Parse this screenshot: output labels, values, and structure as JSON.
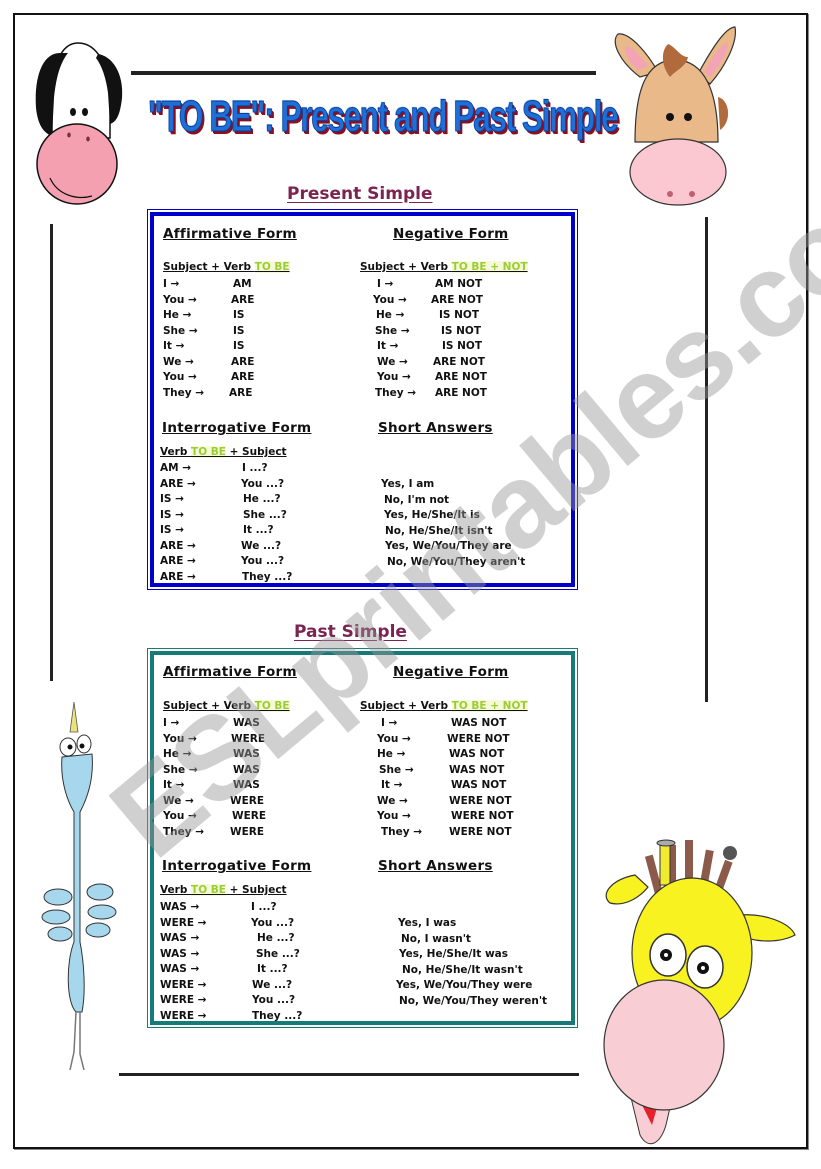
{
  "title": "\"TO BE\": Present and Past Simple",
  "watermark": "ESLprintables.com",
  "colors": {
    "title_blue": "#1f6fd6",
    "title_shadow": "#8a1020",
    "section_title": "#7b2452",
    "present_border": "#0000cc",
    "past_border": "#157a78",
    "highlight": "#9acd32"
  },
  "present": {
    "section_title": "Present Simple",
    "affirmative": {
      "header": "Affirmative Form",
      "formula_prefix": "Subject + Verb ",
      "formula_highlight": "TO BE",
      "rows": [
        {
          "subject": "I →",
          "verb": "AM"
        },
        {
          "subject": "You →",
          "verb": "ARE"
        },
        {
          "subject": "He →",
          "verb": "IS"
        },
        {
          "subject": "She →",
          "verb": "IS"
        },
        {
          "subject": "It →",
          "verb": "IS"
        },
        {
          "subject": "We →",
          "verb": "ARE"
        },
        {
          "subject": "You →",
          "verb": "ARE"
        },
        {
          "subject": "They →",
          "verb": "ARE"
        }
      ]
    },
    "negative": {
      "header": "Negative Form",
      "formula_prefix": "Subject + Verb ",
      "formula_highlight": "TO BE + NOT",
      "rows": [
        {
          "subject": "I →",
          "verb": "AM NOT"
        },
        {
          "subject": "You →",
          "verb": "ARE NOT"
        },
        {
          "subject": "He →",
          "verb": "IS NOT"
        },
        {
          "subject": "She →",
          "verb": "IS NOT"
        },
        {
          "subject": "It →",
          "verb": "IS NOT"
        },
        {
          "subject": "We →",
          "verb": "ARE NOT"
        },
        {
          "subject": "You →",
          "verb": "ARE NOT"
        },
        {
          "subject": "They →",
          "verb": "ARE NOT"
        }
      ]
    },
    "interrogative": {
      "header": "Interrogative Form",
      "formula_prefix": "Verb ",
      "formula_highlight": "TO BE",
      "formula_suffix": " + Subject",
      "rows": [
        {
          "verb": "AM →",
          "subject": "I  ...?"
        },
        {
          "verb": "ARE →",
          "subject": "You ...?"
        },
        {
          "verb": "IS →",
          "subject": "He ...?"
        },
        {
          "verb": "IS →",
          "subject": "She ...?"
        },
        {
          "verb": "IS →",
          "subject": "It  ...?"
        },
        {
          "verb": "ARE →",
          "subject": "We ...?"
        },
        {
          "verb": "ARE →",
          "subject": "You ...?"
        },
        {
          "verb": "ARE →",
          "subject": "They ...?"
        }
      ]
    },
    "short_answers": {
      "header": "Short Answers",
      "items": [
        "Yes, I am",
        "No, I'm not",
        "Yes, He/She/It is",
        "No, He/She/It isn't",
        "Yes, We/You/They are",
        "No, We/You/They aren't"
      ]
    }
  },
  "past": {
    "section_title": "Past Simple",
    "affirmative": {
      "header": "Affirmative Form",
      "formula_prefix": "Subject + Verb ",
      "formula_highlight": "TO BE",
      "rows": [
        {
          "subject": "I →",
          "verb": "WAS"
        },
        {
          "subject": "You →",
          "verb": "WERE"
        },
        {
          "subject": "He →",
          "verb": "WAS"
        },
        {
          "subject": "She →",
          "verb": "WAS"
        },
        {
          "subject": "It →",
          "verb": "WAS"
        },
        {
          "subject": "We →",
          "verb": "WERE"
        },
        {
          "subject": "You →",
          "verb": "WERE"
        },
        {
          "subject": "They →",
          "verb": "WERE"
        }
      ]
    },
    "negative": {
      "header": "Negative Form",
      "formula_prefix": "Subject + Verb ",
      "formula_highlight": "TO BE + NOT",
      "rows": [
        {
          "subject": "I →",
          "verb": "WAS NOT"
        },
        {
          "subject": "You →",
          "verb": "WERE NOT"
        },
        {
          "subject": "He →",
          "verb": "WAS NOT"
        },
        {
          "subject": "She →",
          "verb": "WAS NOT"
        },
        {
          "subject": "It →",
          "verb": "WAS NOT"
        },
        {
          "subject": "We →",
          "verb": "WERE NOT"
        },
        {
          "subject": "You →",
          "verb": "WERE NOT"
        },
        {
          "subject": "They →",
          "verb": "WERE NOT"
        }
      ]
    },
    "interrogative": {
      "header": "Interrogative Form",
      "formula_prefix": "Verb ",
      "formula_highlight": "TO BE",
      "formula_suffix": " + Subject",
      "rows": [
        {
          "verb": "WAS →",
          "subject": "I  ...?"
        },
        {
          "verb": "WERE →",
          "subject": "You ...?"
        },
        {
          "verb": "WAS →",
          "subject": "He ...?"
        },
        {
          "verb": "WAS →",
          "subject": "She ...?"
        },
        {
          "verb": "WAS →",
          "subject": "It  ...?"
        },
        {
          "verb": "WERE →",
          "subject": "We ...?"
        },
        {
          "verb": "WERE →",
          "subject": "You ...?"
        },
        {
          "verb": "WERE →",
          "subject": "They ...?"
        }
      ]
    },
    "short_answers": {
      "header": "Short Answers",
      "items": [
        "Yes, I was",
        "No, I wasn't",
        "Yes, He/She/It was",
        "No, He/She/It wasn't",
        "Yes, We/You/They were",
        "No, We/You/They weren't"
      ]
    }
  },
  "decorations": [
    "cow-icon",
    "donkey-icon",
    "bird-icon",
    "giraffe-icon"
  ]
}
